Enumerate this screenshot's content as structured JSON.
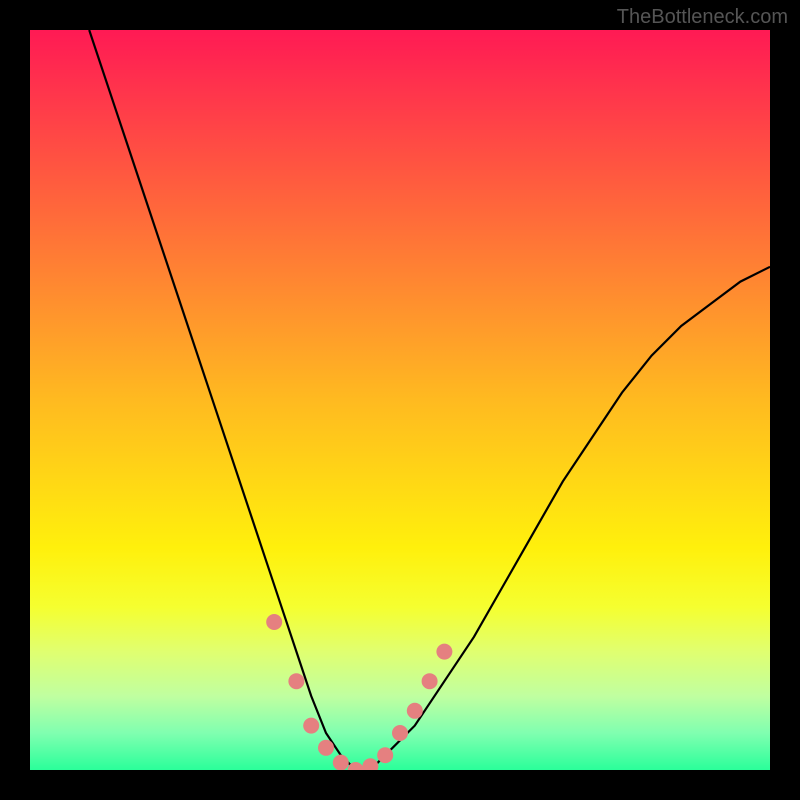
{
  "watermark": "TheBottleneck.com",
  "chart_data": {
    "type": "line",
    "title": "",
    "xlabel": "",
    "ylabel": "",
    "x_range": [
      0,
      100
    ],
    "y_range": [
      0,
      100
    ],
    "gradient_stops": [
      {
        "pos": 0,
        "color": "#ff1a54"
      },
      {
        "pos": 10,
        "color": "#ff3a4a"
      },
      {
        "pos": 20,
        "color": "#ff5a3f"
      },
      {
        "pos": 30,
        "color": "#ff7a35"
      },
      {
        "pos": 40,
        "color": "#ff9a2b"
      },
      {
        "pos": 50,
        "color": "#ffba20"
      },
      {
        "pos": 60,
        "color": "#ffd516"
      },
      {
        "pos": 70,
        "color": "#fff00c"
      },
      {
        "pos": 78,
        "color": "#f5ff30"
      },
      {
        "pos": 84,
        "color": "#e0ff70"
      },
      {
        "pos": 90,
        "color": "#c0ffa0"
      },
      {
        "pos": 95,
        "color": "#80ffb0"
      },
      {
        "pos": 100,
        "color": "#2aff9a"
      }
    ],
    "series": [
      {
        "name": "bottleneck-curve",
        "color": "#000000",
        "x": [
          8,
          12,
          16,
          20,
          24,
          28,
          30,
          32,
          34,
          36,
          38,
          40,
          42,
          44,
          46,
          48,
          52,
          56,
          60,
          64,
          68,
          72,
          76,
          80,
          84,
          88,
          92,
          96,
          100
        ],
        "y": [
          100,
          88,
          76,
          64,
          52,
          40,
          34,
          28,
          22,
          16,
          10,
          5,
          2,
          0,
          0,
          2,
          6,
          12,
          18,
          25,
          32,
          39,
          45,
          51,
          56,
          60,
          63,
          66,
          68
        ]
      }
    ],
    "markers": {
      "name": "highlight-dots",
      "color": "#e58080",
      "points": [
        {
          "x": 33,
          "y": 20
        },
        {
          "x": 36,
          "y": 12
        },
        {
          "x": 38,
          "y": 6
        },
        {
          "x": 40,
          "y": 3
        },
        {
          "x": 42,
          "y": 1
        },
        {
          "x": 44,
          "y": 0
        },
        {
          "x": 46,
          "y": 0.5
        },
        {
          "x": 48,
          "y": 2
        },
        {
          "x": 50,
          "y": 5
        },
        {
          "x": 52,
          "y": 8
        },
        {
          "x": 54,
          "y": 12
        },
        {
          "x": 56,
          "y": 16
        }
      ]
    }
  }
}
